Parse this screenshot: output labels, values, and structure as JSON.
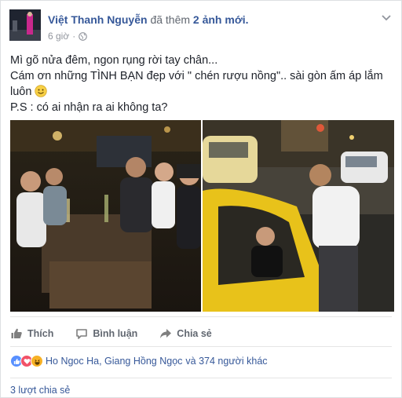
{
  "post": {
    "author_name": "Việt Thanh Nguyễn",
    "action_text": "đã thêm",
    "photo_count_text": "2 ảnh mới.",
    "timestamp": "6 giờ",
    "audience_icon": "globe-icon",
    "text_lines": [
      "Mì gõ nửa đêm, ngon rụng rời tay chân...",
      "Cám ơn những TÌNH BẠN đẹp với \" chén rượu nồng\".. sài gòn ấm áp lắm",
      "luôn",
      "P.S : có ai nhận ra ai không ta?"
    ]
  },
  "actions": {
    "like_label": "Thích",
    "comment_label": "Bình luận",
    "share_label": "Chia sẻ"
  },
  "reactions": {
    "icons": [
      "like-icon",
      "love-icon",
      "haha-icon"
    ],
    "names_text": "Ho Ngoc Ha, Giang Hồng Ngọc",
    "others_text": "và 374 người khác"
  },
  "shares": {
    "text": "3 lượt chia sẻ"
  },
  "colors": {
    "link": "#365899",
    "muted": "#616770",
    "meta": "#90949c",
    "like_blue": "#5890ff",
    "love_red": "#f25268",
    "haha_yellow": "#f7b125"
  }
}
